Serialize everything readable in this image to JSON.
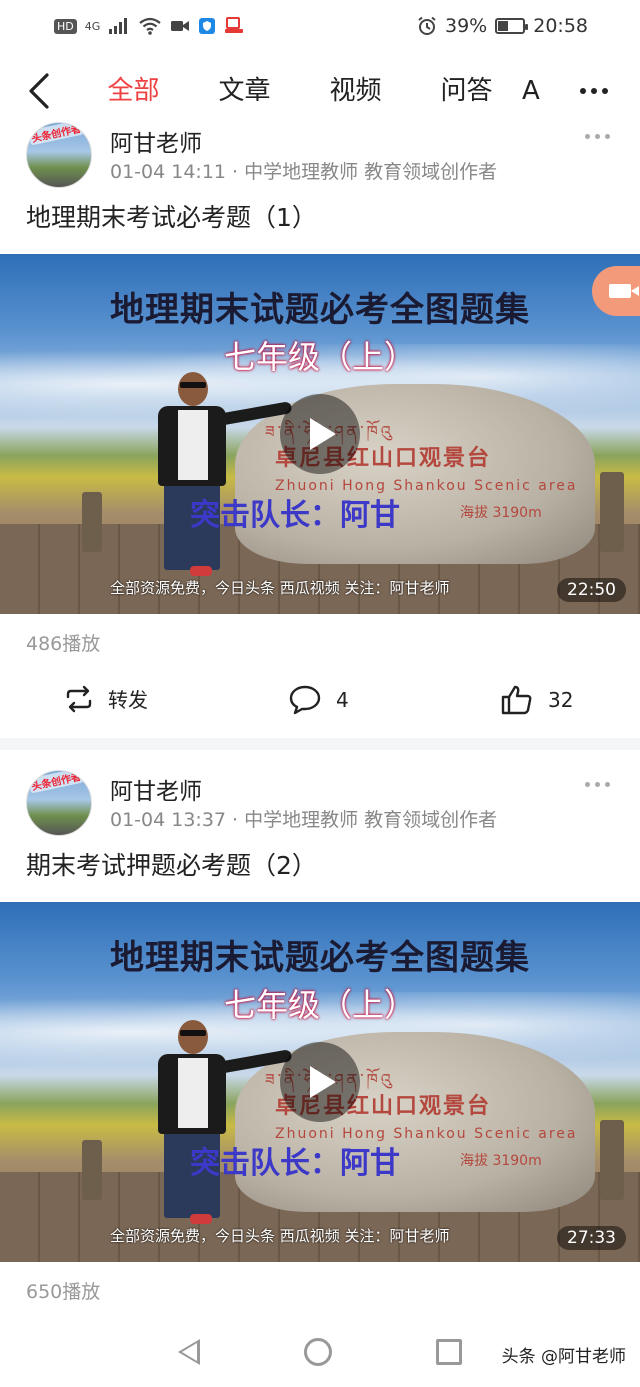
{
  "status_bar": {
    "left_icons": [
      "HD",
      "4G",
      "signal-icon",
      "wifi-icon",
      "video-icon",
      "shield-icon",
      "app-icon"
    ],
    "hd": "HD",
    "net": "4G",
    "alarm_icon": "alarm-icon",
    "battery_percent": "39%",
    "battery_level": 0.39,
    "time": "20:58"
  },
  "nav": {
    "tabs": [
      "全部",
      "文章",
      "视频",
      "问答",
      "A"
    ],
    "active_tab": 0,
    "accent_color": "#f04142"
  },
  "posts": [
    {
      "author": "阿甘老师",
      "avatar_badge": "头条创作者",
      "meta": "01-04 14:11 · 中学地理教师 教育领域创作者",
      "title": "地理期末考试必考题（1）",
      "video": {
        "headline": "地理期末试题必考全图题集",
        "subheadline": "七年级（上）",
        "caption": "突击队长：阿甘",
        "stone_tibetan": "ཟ་ནི་ཧོང་ཤན་ཁོའུ",
        "stone_chinese": "卓尼县红山口观景台",
        "stone_english": "Zhuoni Hong Shankou Scenic area",
        "stone_altitude": "海拔 3190m",
        "bottom_text": "全部资源免费，今日头条 西瓜视频   关注：阿甘老师",
        "duration": "22:50"
      },
      "plays": "486播放",
      "share_label": "转发",
      "comments": "4",
      "likes": "32"
    },
    {
      "author": "阿甘老师",
      "avatar_badge": "头条创作者",
      "meta": "01-04 13:37 · 中学地理教师 教育领域创作者",
      "title": "期末考试押题必考题（2）",
      "video": {
        "headline": "地理期末试题必考全图题集",
        "subheadline": "七年级（上）",
        "caption": "突击队长：阿甘",
        "stone_tibetan": "ཟ་ནི་ཧོང་ཤན་ཁོའུ",
        "stone_chinese": "卓尼县红山口观景台",
        "stone_english": "Zhuoni Hong Shankou Scenic area",
        "stone_altitude": "海拔 3190m",
        "bottom_text": "全部资源免费，今日头条 西瓜视频   关注：阿甘老师",
        "duration": "27:33"
      },
      "plays": "650播放"
    }
  ],
  "watermark": "头条 @阿甘老师"
}
